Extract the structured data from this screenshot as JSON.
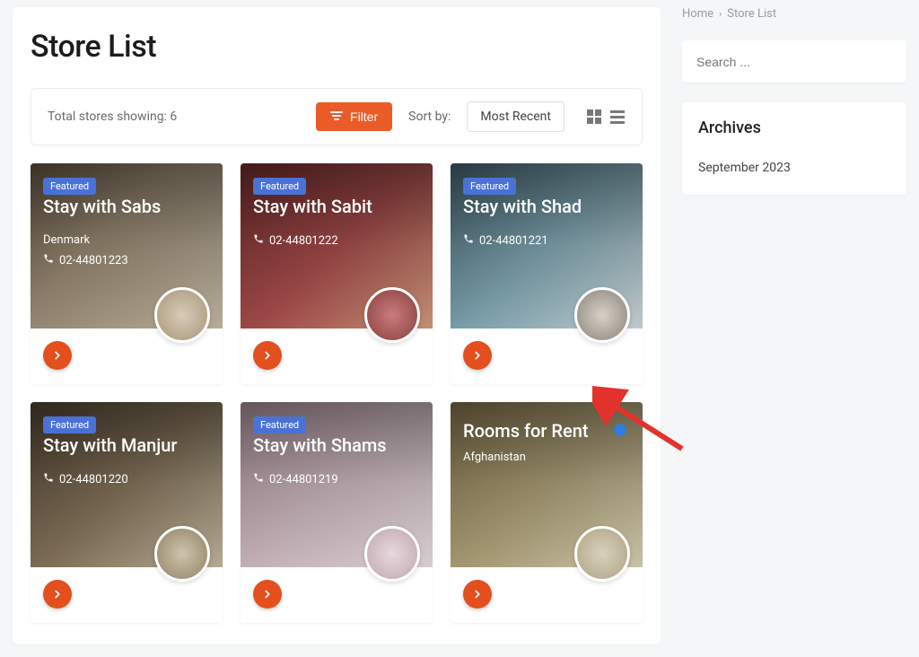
{
  "breadcrumb": {
    "home": "Home",
    "current": "Store List"
  },
  "page": {
    "title": "Store List"
  },
  "toolbar": {
    "count_text": "Total stores showing: 6",
    "filter_label": "Filter",
    "sort_label": "Sort by:",
    "sort_value": "Most Recent"
  },
  "sidebar": {
    "search_placeholder": "Search ...",
    "archives_title": "Archives",
    "archives_items": [
      "September 2023"
    ]
  },
  "stores": [
    {
      "featured": true,
      "title": "Stay with Sabs",
      "location": "Denmark",
      "phone": "02-44801223",
      "verified": false
    },
    {
      "featured": true,
      "title": "Stay with Sabit",
      "location": "",
      "phone": "02-44801222",
      "verified": false
    },
    {
      "featured": true,
      "title": "Stay with Shad",
      "location": "",
      "phone": "02-44801221",
      "verified": false
    },
    {
      "featured": true,
      "title": "Stay with Manjur",
      "location": "",
      "phone": "02-44801220",
      "verified": false
    },
    {
      "featured": true,
      "title": "Stay with Shams",
      "location": "",
      "phone": "02-44801219",
      "verified": false
    },
    {
      "featured": false,
      "title": "Rooms for Rent",
      "location": "Afghanistan",
      "phone": "",
      "verified": true
    }
  ],
  "labels": {
    "featured": "Featured"
  }
}
